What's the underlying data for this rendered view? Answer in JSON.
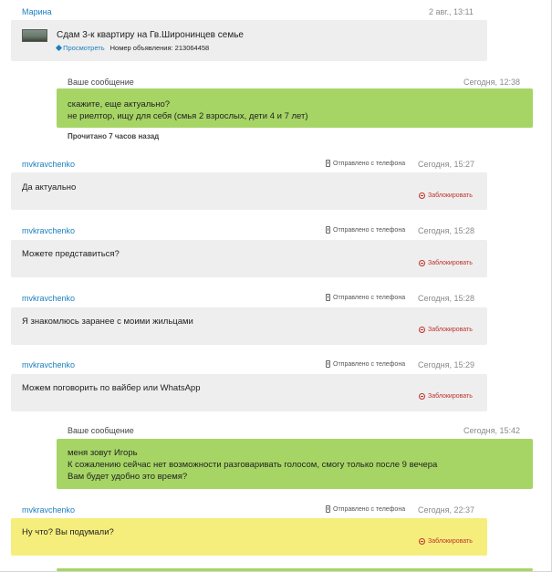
{
  "listing": {
    "sender": "Марина",
    "date": "2 авг., 13:11",
    "title": "Сдам 3-к квартиру на Гв.Широнинцев семье",
    "view_label": "Просмотреть",
    "number_label": "Номер объявления: 213064458"
  },
  "messages": [
    {
      "own": true,
      "label": "Ваше сообщение",
      "date": "Сегодня, 12:38",
      "lines": [
        "скажите, еще актуально?",
        "не риелтор, ищу для себя (смья 2 взрослых, дети 4 и 7 лет)"
      ],
      "status": "Прочитано 7 часов назад"
    },
    {
      "own": false,
      "sender": "mvkravchenko",
      "phone_label": "Отправлено с телефона",
      "date": "Сегодня, 15:27",
      "lines": [
        "Да актуально"
      ],
      "block_label": "Заблокировать"
    },
    {
      "own": false,
      "sender": "mvkravchenko",
      "phone_label": "Отправлено с телефона",
      "date": "Сегодня, 15:28",
      "lines": [
        "Можете представиться?"
      ],
      "block_label": "Заблокировать"
    },
    {
      "own": false,
      "sender": "mvkravchenko",
      "phone_label": "Отправлено с телефона",
      "date": "Сегодня, 15:28",
      "lines": [
        "Я знакомлюсь заранее с моими жильцами"
      ],
      "block_label": "Заблокировать"
    },
    {
      "own": false,
      "sender": "mvkravchenko",
      "phone_label": "Отправлено с телефона",
      "date": "Сегодня, 15:29",
      "lines": [
        "Можем поговорить по вайбер или WhatsApp"
      ],
      "block_label": "Заблокировать"
    },
    {
      "own": true,
      "label": "Ваше сообщение",
      "date": "Сегодня, 15:42",
      "lines": [
        "меня зовут Игорь",
        "К сожалению сейчас нет возможности разговаривать голосом, смогу только после 9 вечера",
        "Вам будет удобно это время?"
      ]
    },
    {
      "own": false,
      "highlighted": true,
      "sender": "mvkravchenko",
      "phone_label": "Отправлено с телефона",
      "date": "Сегодня, 22:37",
      "lines": [
        "Ну что? Вы подумали?"
      ],
      "block_label": "Заблокировать"
    }
  ],
  "colors": {
    "own_bubble": "#a6d565",
    "incoming_bubble": "#eeeeee",
    "unread_bubble": "#f6ee7c",
    "link": "#1a7fbf",
    "block": "#c0322b"
  }
}
